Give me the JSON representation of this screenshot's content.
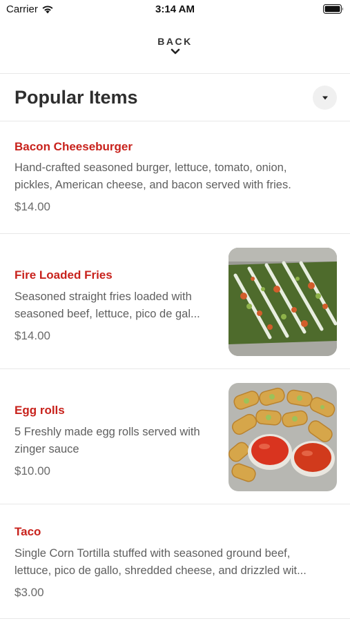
{
  "status_bar": {
    "carrier": "Carrier",
    "time": "3:14 AM"
  },
  "nav": {
    "back_label": "BACK"
  },
  "section": {
    "title": "Popular Items"
  },
  "items": [
    {
      "name": "Bacon Cheeseburger",
      "description_line1": "Hand-crafted seasoned burger, lettuce, tomato, onion,",
      "description_line2": "pickles, American cheese, and bacon served with fries.",
      "price": "$14.00"
    },
    {
      "name": "Fire Loaded Fries",
      "description_line1": "Seasoned straight fries loaded with",
      "description_line2": "seasoned beef, lettuce, pico de gal...",
      "price": "$14.00",
      "image": "loaded-fries-photo"
    },
    {
      "name": "Egg rolls",
      "description_line1": "5 Freshly made egg rolls served with",
      "description_line2": "zinger sauce",
      "price": "$10.00",
      "image": "egg-rolls-photo"
    },
    {
      "name": "Taco",
      "description_line1": "Single Corn Tortilla stuffed with seasoned ground beef,",
      "description_line2": "lettuce, pico de gallo, shredded cheese, and drizzled wit...",
      "price": "$3.00"
    }
  ],
  "colors": {
    "item_name": "#c8221c",
    "description": "#5f5f5f",
    "title": "#2e2e2e",
    "divider": "#e8e8e8"
  }
}
